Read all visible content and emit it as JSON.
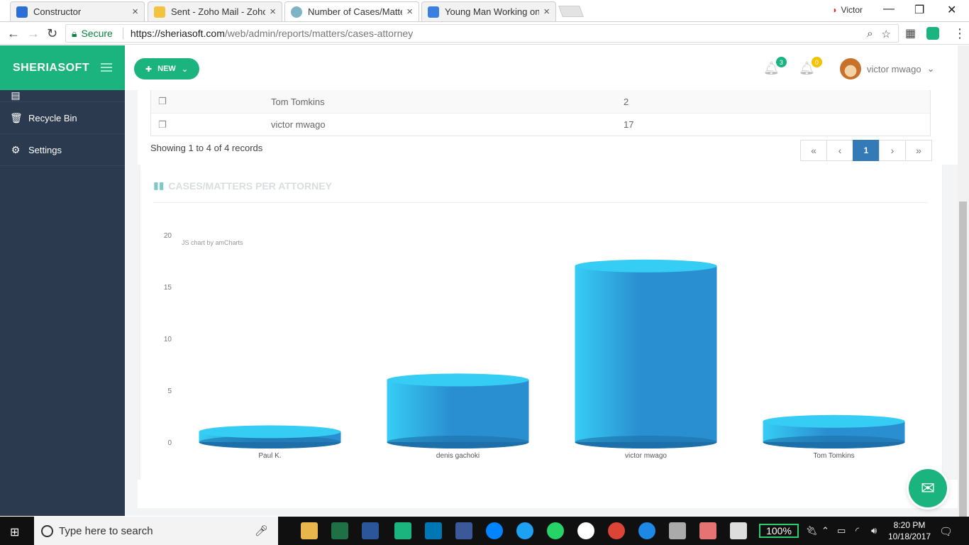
{
  "browser": {
    "tabs": [
      {
        "title": "Constructor",
        "close": "×"
      },
      {
        "title": "Sent - Zoho Mail - Zoho",
        "close": "×"
      },
      {
        "title": "Number of Cases/Matter",
        "close": "×"
      },
      {
        "title": "Young Man Working on",
        "close": "×"
      }
    ],
    "window_user": "Victor",
    "secure_label": "Secure",
    "url_host": "https://sheriasoft.com",
    "url_path": "/web/admin/reports/matters/cases-attorney"
  },
  "app": {
    "brand": "SHERIASOFT",
    "new_button": "NEW",
    "notifications_count": "3",
    "alerts_count": "0",
    "user_name": "victor mwago"
  },
  "sidebar": {
    "items": [
      {
        "label": "Recycle Bin"
      },
      {
        "label": "Settings"
      }
    ]
  },
  "table": {
    "rows": [
      {
        "name": "Tom Tomkins",
        "count": "2"
      },
      {
        "name": "victor mwago",
        "count": "17"
      }
    ],
    "showing": "Showing 1 to 4 of 4 records",
    "pager": {
      "first": "«",
      "prev": "‹",
      "page": "1",
      "next": "›",
      "last": "»"
    }
  },
  "chart_title": "CASES/MATTERS PER ATTORNEY",
  "chart_data": {
    "type": "bar",
    "title": "CASES/MATTERS PER ATTORNEY",
    "watermark": "JS chart by amCharts",
    "categories": [
      "Paul K.",
      "denis gachoki",
      "victor mwago",
      "Tom Tomkins"
    ],
    "values": [
      1,
      6,
      17,
      2
    ],
    "yticks": [
      "0",
      "5",
      "10",
      "15",
      "20"
    ],
    "ylim": [
      0,
      20
    ],
    "colors": {
      "body": "#2a8fd0",
      "top": "#36cdf5",
      "shade": "#1d6fa8"
    }
  },
  "taskbar": {
    "search_placeholder": "Type here to search",
    "battery": "100%",
    "time": "8:20 PM",
    "date": "10/18/2017"
  }
}
